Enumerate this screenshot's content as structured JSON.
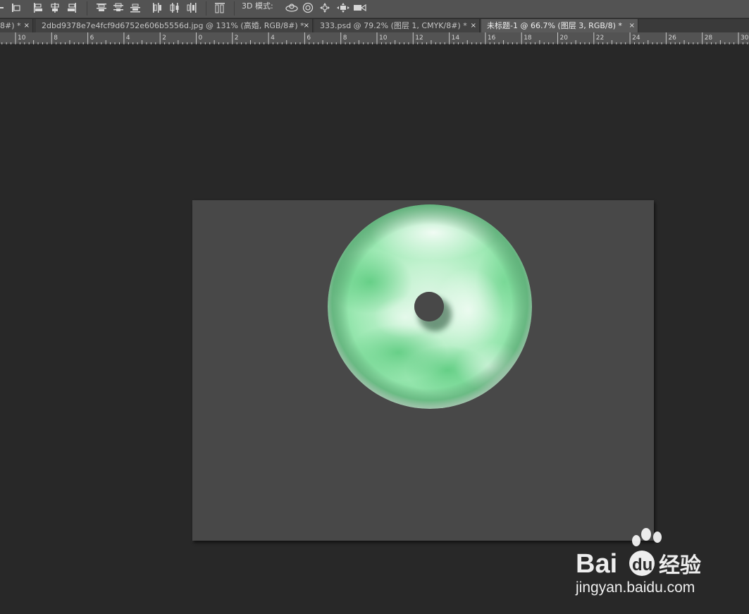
{
  "toolbar": {
    "align_icons": [
      "align-left-partial-icon",
      "align-top-edges-icon",
      "align-left-edges-icon",
      "align-horizontal-centers-icon",
      "align-right-edges-icon"
    ],
    "distribute_icons": [
      "distribute-top-icon",
      "distribute-vertical-centers-icon",
      "distribute-bottom-icon",
      "distribute-left-icon",
      "distribute-horizontal-centers-icon",
      "distribute-right-icon"
    ],
    "auto_align_icon": "auto-align-layers-icon",
    "mode_label": "3D 模式:",
    "mode_icons": [
      "rotate-3d-icon",
      "roll-3d-icon",
      "pan-3d-icon",
      "slide-3d-icon",
      "scale-3d-icon"
    ]
  },
  "tabs": [
    {
      "label": "8#) *",
      "close": "×",
      "active": false
    },
    {
      "label": "2dbd9378e7e4fcf9d6752e606b5556d.jpg @ 131% (高婚, RGB/8#) *",
      "close": "×",
      "active": false
    },
    {
      "label": "333.psd @ 79.2% (图层 1, CMYK/8#) *",
      "close": "×",
      "active": false
    },
    {
      "label": "未标题-1 @ 66.7% (图层 3, RGB/8) *",
      "close": "×",
      "active": true
    }
  ],
  "ruler": {
    "labels": [
      "10",
      "8",
      "6",
      "4",
      "2",
      "0",
      "2",
      "4",
      "6",
      "8",
      "10",
      "12",
      "14",
      "16",
      "18",
      "20",
      "22",
      "24",
      "26",
      "28",
      "30"
    ]
  },
  "document": {
    "background_color": "#484848",
    "jade_colors": [
      "#e6f7ea",
      "#b9f0c8",
      "#8fe2a6",
      "#5cc97e"
    ]
  },
  "watermark": {
    "brand_text": "Bai",
    "brand_text_2": "du",
    "brand_cn": "经验",
    "url": "jingyan.baidu.com"
  }
}
